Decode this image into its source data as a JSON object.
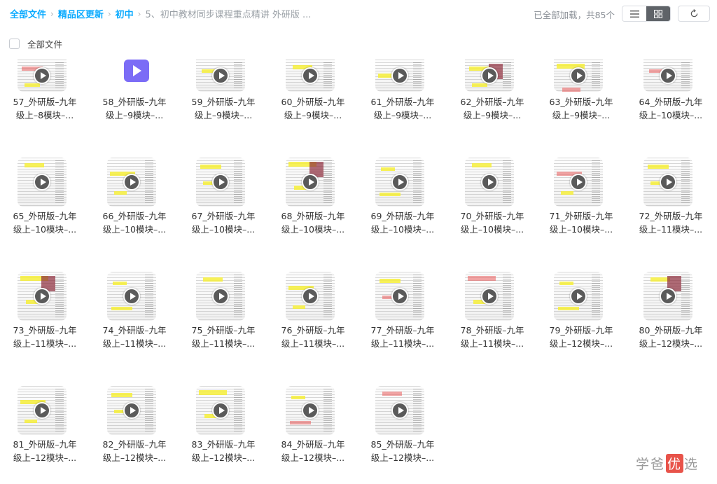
{
  "breadcrumb": {
    "items": [
      "全部文件",
      "精品区更新",
      "初中"
    ],
    "current": "5、初中教材同步课程重点精讲 外研版 ..."
  },
  "status_text": "已全部加载，共85个",
  "select_all_label": "全部文件",
  "watermark": {
    "pre": "学爸",
    "badge": "优",
    "post": "选"
  },
  "files": [
    {
      "line1": "57_外研版–九年",
      "line2": "级上–8模块–..."
    },
    {
      "line1": "58_外研版–九年",
      "line2": "级上–9模块–..."
    },
    {
      "line1": "59_外研版–九年",
      "line2": "级上–9模块–..."
    },
    {
      "line1": "60_外研版–九年",
      "line2": "级上–9模块–..."
    },
    {
      "line1": "61_外研版–九年",
      "line2": "级上–9模块–..."
    },
    {
      "line1": "62_外研版–九年",
      "line2": "级上–9模块–..."
    },
    {
      "line1": "63_外研版–九年",
      "line2": "级上–9模块–..."
    },
    {
      "line1": "64_外研版–九年",
      "line2": "级上–10模块–..."
    },
    {
      "line1": "65_外研版–九年",
      "line2": "级上–10模块–..."
    },
    {
      "line1": "66_外研版–九年",
      "line2": "级上–10模块–..."
    },
    {
      "line1": "67_外研版–九年",
      "line2": "级上–10模块–..."
    },
    {
      "line1": "68_外研版–九年",
      "line2": "级上–10模块–..."
    },
    {
      "line1": "69_外研版–九年",
      "line2": "级上–10模块–..."
    },
    {
      "line1": "70_外研版–九年",
      "line2": "级上–10模块–..."
    },
    {
      "line1": "71_外研版–九年",
      "line2": "级上–10模块–..."
    },
    {
      "line1": "72_外研版–九年",
      "line2": "级上–11模块–..."
    },
    {
      "line1": "73_外研版–九年",
      "line2": "级上–11模块–..."
    },
    {
      "line1": "74_外研版–九年",
      "line2": "级上–11模块–..."
    },
    {
      "line1": "75_外研版–九年",
      "line2": "级上–11模块–..."
    },
    {
      "line1": "76_外研版–九年",
      "line2": "级上–11模块–..."
    },
    {
      "line1": "77_外研版–九年",
      "line2": "级上–11模块–..."
    },
    {
      "line1": "78_外研版–九年",
      "line2": "级上–11模块–..."
    },
    {
      "line1": "79_外研版–九年",
      "line2": "级上–12模块–..."
    },
    {
      "line1": "80_外研版–九年",
      "line2": "级上–12模块–..."
    },
    {
      "line1": "81_外研版–九年",
      "line2": "级上–12模块–..."
    },
    {
      "line1": "82_外研版–九年",
      "line2": "级上–12模块–..."
    },
    {
      "line1": "83_外研版–九年",
      "line2": "级上–12模块–..."
    },
    {
      "line1": "84_外研版–九年",
      "line2": "级上–12模块–..."
    },
    {
      "line1": "85_外研版–九年",
      "line2": "级上–12模块–..."
    }
  ],
  "colors": {
    "accent": "#09aaff",
    "video_icon": "#7b6cf6",
    "active_toggle": "#5f6368"
  }
}
